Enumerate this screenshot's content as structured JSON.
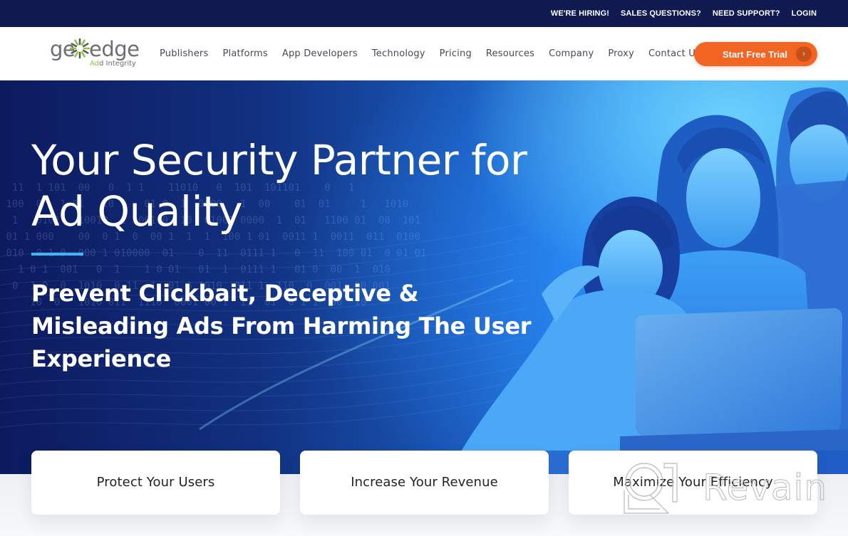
{
  "topbar": {
    "links": [
      "WE'RE HIRING!",
      "SALES QUESTIONS?",
      "NEED SUPPORT?",
      "LOGIN"
    ]
  },
  "logo": {
    "word_left": "ge",
    "word_right": "edge",
    "tagline_accent": "Ad",
    "tagline_rest": "d Integrity"
  },
  "nav": {
    "items": [
      "Publishers",
      "Platforms",
      "App Developers",
      "Technology",
      "Pricing",
      "Resources",
      "Company",
      "Proxy",
      "Contact Us"
    ],
    "cta_label": "Start Free Trial",
    "cta_icon": "chevron-right-icon"
  },
  "hero": {
    "title": "Your Security Partner for Ad Quality",
    "subtitle": "Prevent Clickbait, Deceptive & Misleading Ads From Harming The User Experience",
    "image": "family-using-laptop-photo"
  },
  "features": [
    {
      "label": "Protect Your Users"
    },
    {
      "label": "Increase Your Revenue"
    },
    {
      "label": "Maximize Your Efficiency"
    }
  ],
  "watermark": {
    "text": "Revain"
  },
  "colors": {
    "topbar_bg": "#101950",
    "cta": "#f26522",
    "logo_green": "#8dc63f",
    "accent_line": "#3fb6f2"
  }
}
